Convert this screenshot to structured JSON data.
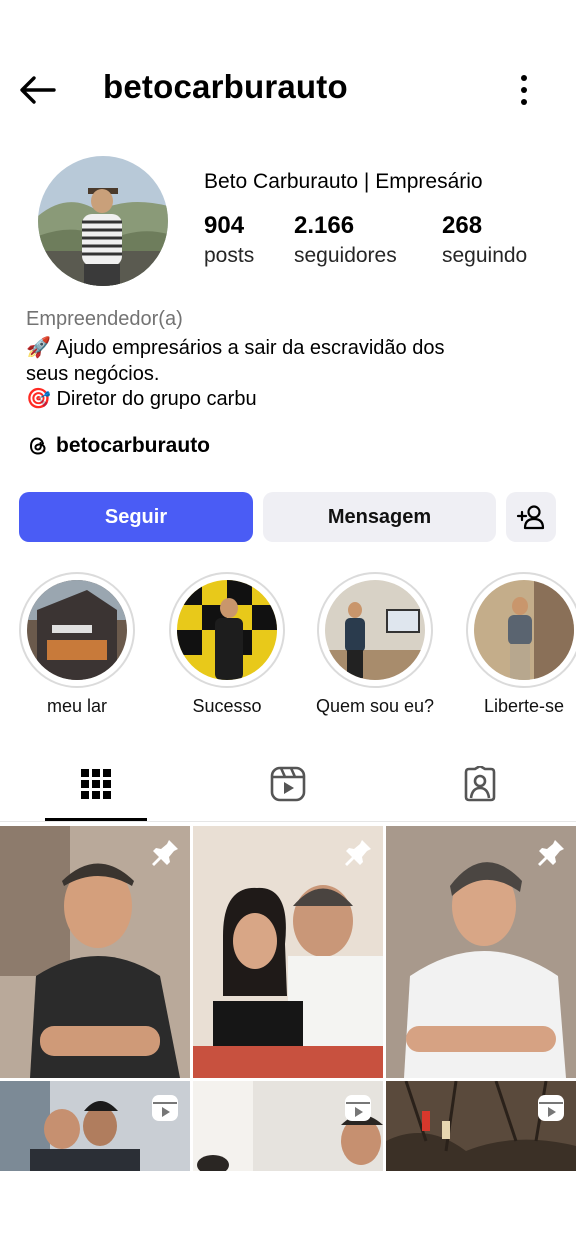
{
  "header": {
    "username": "betocarburauto"
  },
  "profile": {
    "display_name": "Beto Carburauto | Empresário",
    "stats": [
      {
        "value": "904",
        "label": "posts"
      },
      {
        "value": "2.166",
        "label": "seguidores"
      },
      {
        "value": "268",
        "label": "seguindo"
      }
    ],
    "category": "Empreendedor(a)",
    "bio_lines": [
      "🚀 Ajudo empresários a sair da escravidão dos",
      "seus negócios.",
      "🎯 Diretor do grupo carbu"
    ],
    "threads_handle": "betocarburauto"
  },
  "actions": {
    "follow": "Seguir",
    "message": "Mensagem"
  },
  "highlights": [
    {
      "label": "meu lar"
    },
    {
      "label": "Sucesso"
    },
    {
      "label": "Quem sou eu?"
    },
    {
      "label": "Liberte-se"
    }
  ],
  "tabs": [
    "grid-icon",
    "reels-icon",
    "tagged-icon"
  ],
  "grid": [
    {
      "type": "pinned-post"
    },
    {
      "type": "pinned-post"
    },
    {
      "type": "pinned-post"
    },
    {
      "type": "reel"
    },
    {
      "type": "reel"
    },
    {
      "type": "reel"
    }
  ],
  "colors": {
    "primary_button": "#4a5cf5",
    "secondary_button": "#efeff4",
    "muted_text": "#737373"
  }
}
